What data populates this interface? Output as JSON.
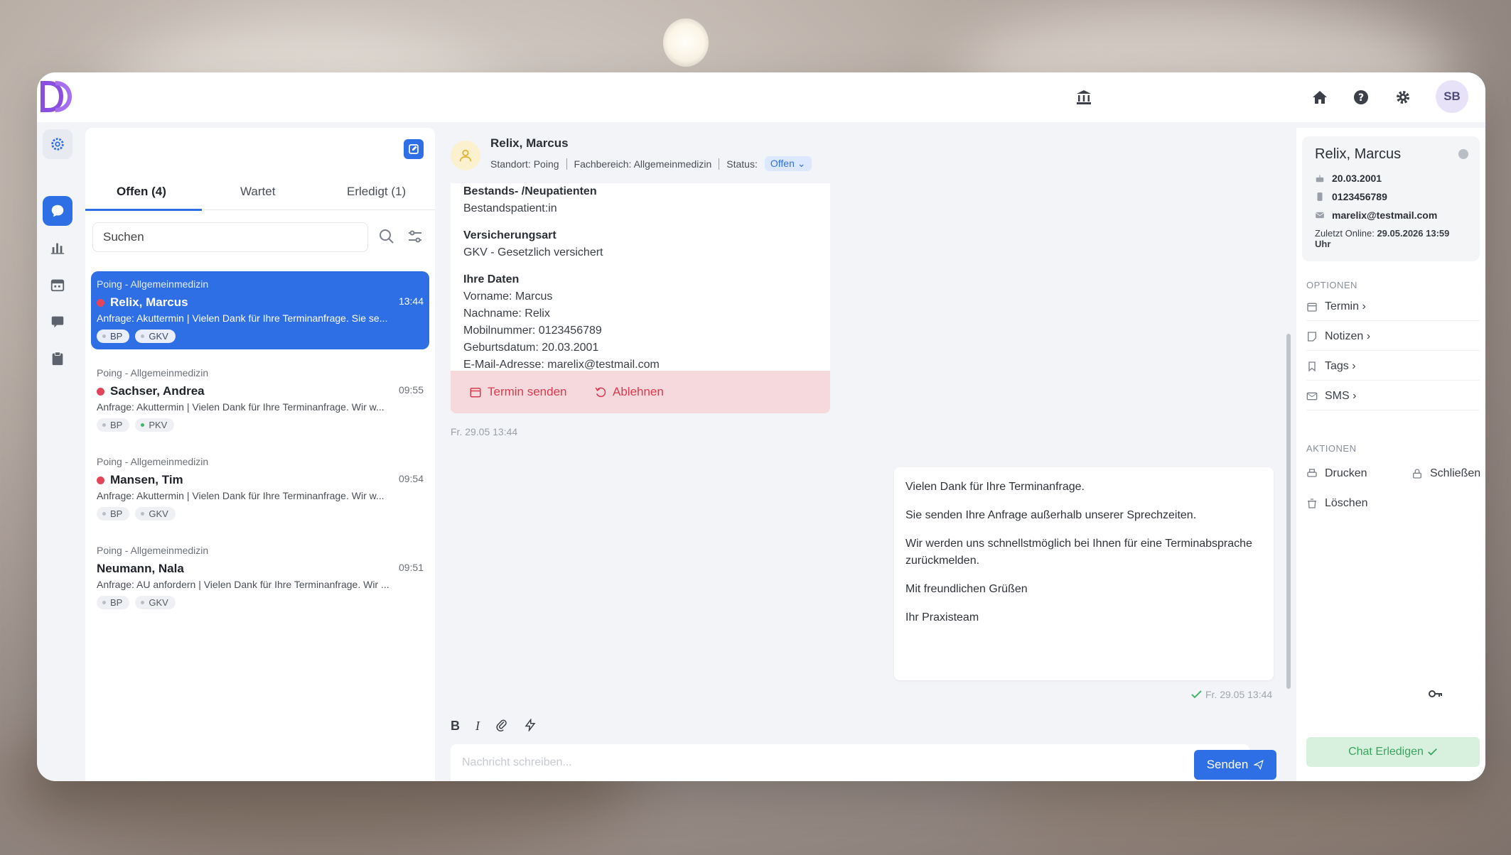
{
  "header": {
    "initials": "SB"
  },
  "conversation_list": {
    "tabs": [
      {
        "label": "Offen  (4)"
      },
      {
        "label": "Wartet"
      },
      {
        "label": "Erledigt  (1)"
      }
    ],
    "search_placeholder": "Suchen",
    "items": [
      {
        "location": "Poing - Allgemeinmedizin",
        "name": "Relix, Marcus",
        "time": "13:44",
        "preview": "Anfrage: Akuttermin | Vielen Dank für Ihre Terminanfrage. Sie se...",
        "tags": [
          "BP",
          "GKV"
        ],
        "unread": true
      },
      {
        "location": "Poing - Allgemeinmedizin",
        "name": "Sachser, Andrea",
        "time": "09:55",
        "preview": "Anfrage: Akuttermin | Vielen Dank für Ihre Terminanfrage. Wir w...",
        "tags": [
          "BP",
          "PKV"
        ],
        "unread": true
      },
      {
        "location": "Poing - Allgemeinmedizin",
        "name": "Mansen, Tim",
        "time": "09:54",
        "preview": "Anfrage: Akuttermin | Vielen Dank für Ihre Terminanfrage. Wir w...",
        "tags": [
          "BP",
          "GKV"
        ],
        "unread": true
      },
      {
        "location": "Poing - Allgemeinmedizin",
        "name": "Neumann, Nala",
        "time": "09:51",
        "preview": "Anfrage: AU anfordern | Vielen Dank für Ihre Terminanfrage. Wir ...",
        "tags": [
          "BP",
          "GKV"
        ],
        "unread": false
      }
    ]
  },
  "chat": {
    "name": "Relix, Marcus",
    "standort": "Standort: Poing",
    "fachbereich": "Fachbereich: Allgemeinmedizin",
    "status_label": "Status:",
    "status_value": "Offen",
    "form": {
      "patient_type_title": "Bestands- /Neupatienten",
      "patient_type_value": "Bestandspatient:in",
      "insurance_title": "Versicherungsart",
      "insurance_value": "GKV - Gesetzlich versichert",
      "data_title": "Ihre Daten",
      "vorname": "Vorname: Marcus",
      "nachname": "Nachname: Relix",
      "mobil": "Mobilnummer: 0123456789",
      "geburtsdatum": "Geburtsdatum: 20.03.2001",
      "email": "E-Mail-Adresse: marelix@testmail.com"
    },
    "actions": {
      "send_appointment": "Termin senden",
      "decline": "Ablehnen"
    },
    "request_timestamp": "Fr. 29.05 13:44",
    "reply": [
      "Vielen Dank für Ihre Terminanfrage.",
      "Sie senden Ihre Anfrage außerhalb unserer Sprechzeiten.",
      "Wir werden uns schnellstmöglich bei Ihnen für eine Terminabsprache zurückmelden.",
      "Mit freundlichen Grüßen",
      "Ihr Praxisteam"
    ],
    "reply_timestamp": "Fr. 29.05 13:44",
    "input_placeholder": "Nachricht schreiben...",
    "send_label": "Senden"
  },
  "patient": {
    "name": "Relix, Marcus",
    "birthdate": "20.03.2001",
    "phone": "0123456789",
    "email": "marelix@testmail.com",
    "last_online_label": "Zuletzt Online:",
    "last_online_value": "29.05.2026 13:59 Uhr"
  },
  "options": {
    "title": "OPTIONEN",
    "items": [
      "Termin ›",
      "Notizen ›",
      "Tags ›",
      "SMS ›"
    ]
  },
  "aktionen": {
    "title": "AKTIONEN",
    "print": "Drucken",
    "close": "Schließen",
    "delete": "Löschen"
  },
  "done_label": "Chat Erledigen",
  "colors": {
    "accent": "#2f6fe6",
    "danger": "#d93a4f",
    "success": "#3aa35e",
    "logo": "#8a4fe0"
  }
}
